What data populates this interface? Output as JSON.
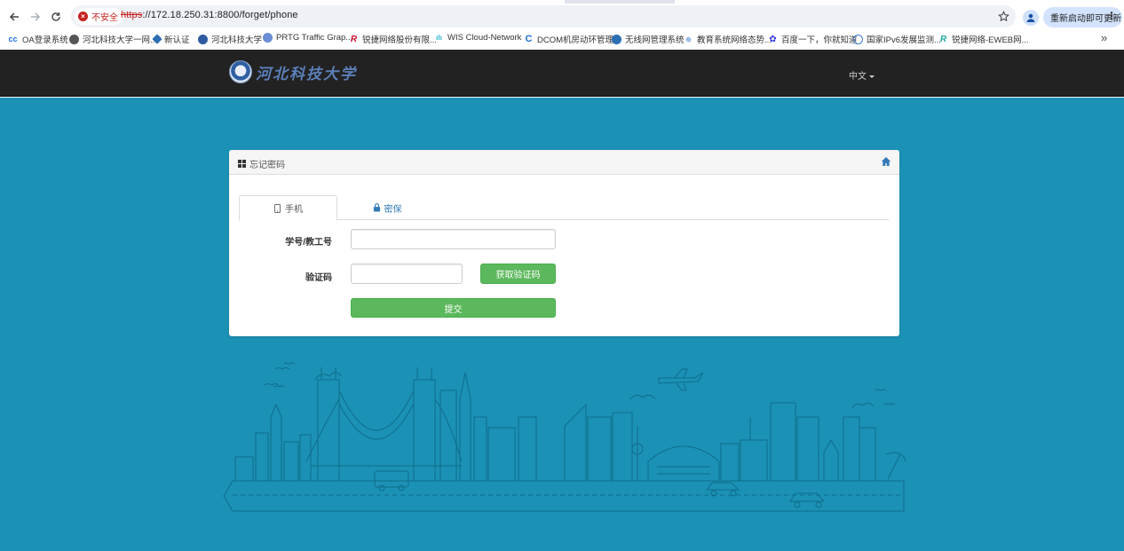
{
  "browser": {
    "back_icon": "arrow-left-icon",
    "reload_icon": "reload-icon",
    "security_label": "不安全",
    "url_scheme": "https",
    "url_rest": "://172.18.250.31:8800/forget/phone",
    "update_label": "重新启动即可更新",
    "bookmarks": [
      {
        "label": "OA登录系统",
        "color": "#1a73e8"
      },
      {
        "label": "河北科技大学一网...",
        "color": "#555555"
      },
      {
        "label": "新认证",
        "color": "#2d6fb3"
      },
      {
        "label": "河北科技大学",
        "color": "#2d5aa0"
      },
      {
        "label": "PRTG Traffic Grap...",
        "color": "#6b8ed6"
      },
      {
        "label": "锐捷网络股份有限...",
        "color": "#c8102e"
      },
      {
        "label": "WIS Cloud-Network",
        "color": "#27b5c9"
      },
      {
        "label": "DCOM机房动环管理",
        "color": "#1e6fd9"
      },
      {
        "label": "无线网管理系统",
        "color": "#2d6fb3"
      },
      {
        "label": "教育系统网络态势...",
        "color": "#7aa7d9"
      },
      {
        "label": "百度一下，你就知道",
        "color": "#2932e1"
      },
      {
        "label": "国家IPv6发展监测...",
        "color": "#3a7bd5"
      },
      {
        "label": "锐捷网络-EWEB网...",
        "color": "#20a89f"
      }
    ],
    "more_label": "»"
  },
  "header": {
    "logo_text": "河北科技大学",
    "language": "中文"
  },
  "panel": {
    "title": "忘记密码",
    "tabs": [
      {
        "label": "手机",
        "active": true
      },
      {
        "label": "密保",
        "active": false
      }
    ],
    "fields": {
      "id_label": "学号/教工号",
      "id_value": "",
      "code_label": "验证码",
      "code_value": ""
    },
    "get_code_button": "获取验证码",
    "submit_button": "提交"
  },
  "colors": {
    "header_bg": "#222222",
    "page_bg": "#1b91b5",
    "accent_green": "#5cb85c",
    "link_blue": "#337ab7"
  }
}
